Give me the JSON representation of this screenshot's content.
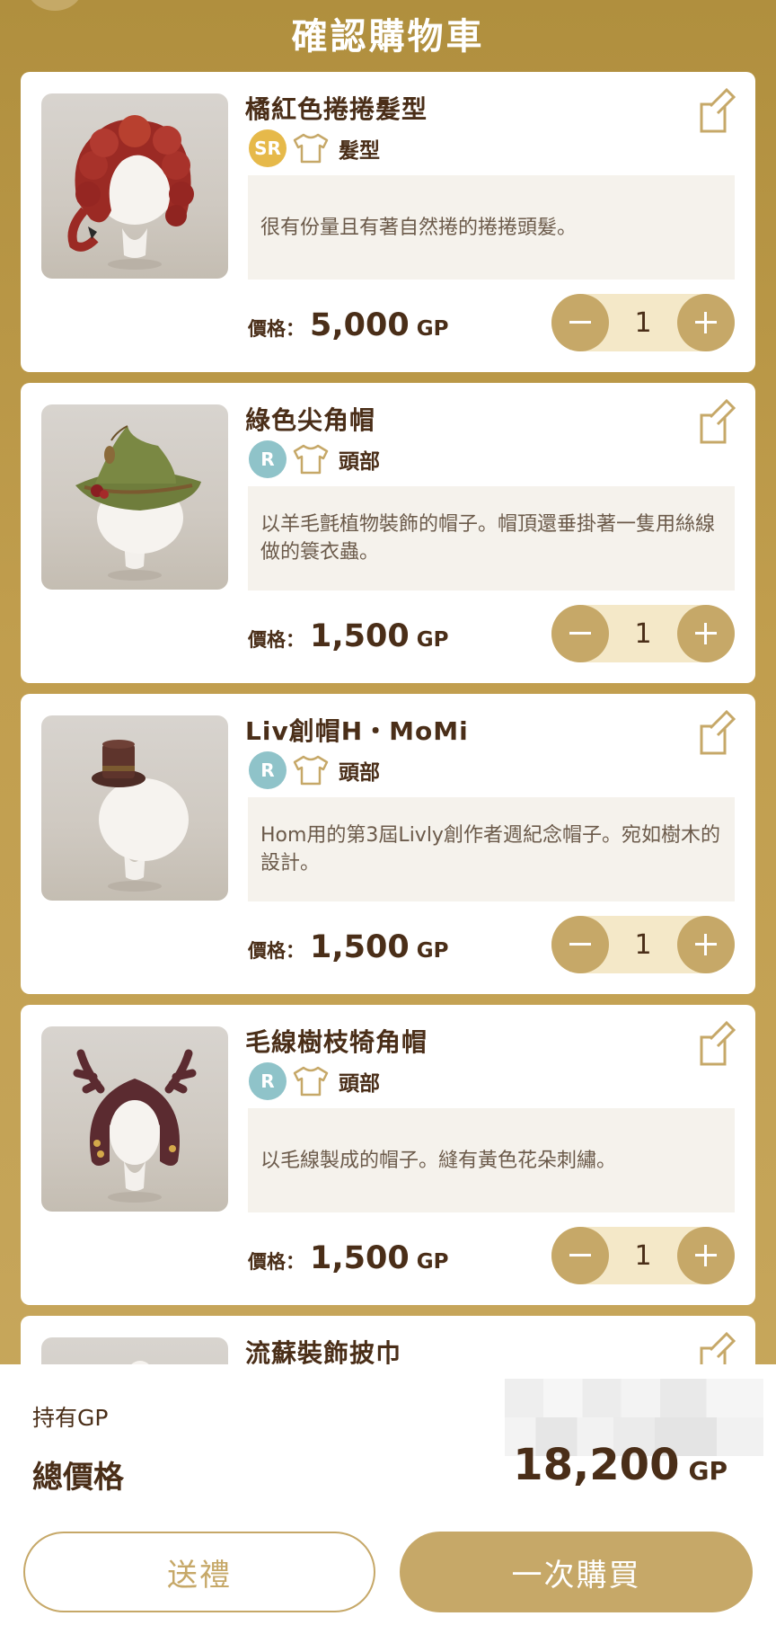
{
  "header": {
    "title": "確認購物車"
  },
  "items": [
    {
      "name": "橘紅色捲捲髮型",
      "rarity": "SR",
      "category": "髮型",
      "description": "很有份量且有著自然捲的捲捲頭髮。",
      "price_label": "價格：",
      "price": "5,000",
      "unit": "GP",
      "quantity": "1",
      "icon": "curly-red-hair"
    },
    {
      "name": "綠色尖角帽",
      "rarity": "R",
      "category": "頭部",
      "description": "以羊毛氈植物裝飾的帽子。帽頂還垂掛著一隻用絲線做的簑衣蟲。",
      "price_label": "價格：",
      "price": "1,500",
      "unit": "GP",
      "quantity": "1",
      "icon": "green-witch-hat"
    },
    {
      "name": "Liv創帽H・MoMi",
      "rarity": "R",
      "category": "頭部",
      "description": "Hom用的第3屆Livly創作者週紀念帽子。宛如樹木的設計。",
      "price_label": "價格：",
      "price": "1,500",
      "unit": "GP",
      "quantity": "1",
      "icon": "brown-top-hat"
    },
    {
      "name": "毛線樹枝犄角帽",
      "rarity": "R",
      "category": "頭部",
      "description": "以毛線製成的帽子。縫有黃色花朵刺繡。",
      "price_label": "價格：",
      "price": "1,500",
      "unit": "GP",
      "quantity": "1",
      "icon": "antler-knit-hat"
    },
    {
      "name": "流蘇裝飾披巾",
      "icon": "tassel-shawl"
    }
  ],
  "footer": {
    "own_gp_label": "持有GP",
    "total_label": "總價格",
    "total_value": "18,200",
    "total_unit": "GP",
    "gift_button": "送禮",
    "buy_button": "一次購買"
  },
  "colors": {
    "background": "#b08f3e",
    "accent": "#c6a868",
    "rarity_sr": "#e6b94a",
    "rarity_r": "#8fc3c9",
    "text": "#4a2e18"
  }
}
